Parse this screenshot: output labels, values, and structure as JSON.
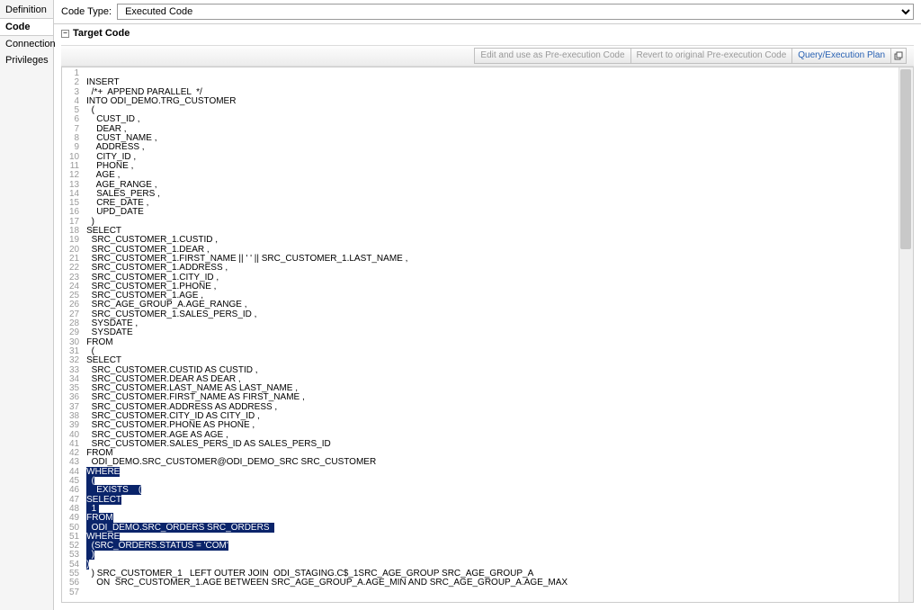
{
  "sidebar": {
    "items": [
      {
        "label": "Definition"
      },
      {
        "label": "Code"
      },
      {
        "label": "Connection"
      },
      {
        "label": "Privileges"
      }
    ],
    "active_index": 1
  },
  "topbar": {
    "label": "Code Type:",
    "selected": "Executed Code"
  },
  "section": {
    "title": "Target Code",
    "collapse_glyph": "−"
  },
  "toolbar": {
    "btn_preexec": "Edit and use as Pre-execution Code",
    "btn_revert": "Revert to original Pre-execution Code",
    "btn_plan": "Query/Execution Plan"
  },
  "code": {
    "lines": [
      {
        "n": 1,
        "t": ""
      },
      {
        "n": 2,
        "t": "INSERT"
      },
      {
        "n": 3,
        "t": "  /*+  APPEND PARALLEL  */"
      },
      {
        "n": 4,
        "t": "INTO ODI_DEMO.TRG_CUSTOMER"
      },
      {
        "n": 5,
        "t": "  ("
      },
      {
        "n": 6,
        "t": "    CUST_ID ,"
      },
      {
        "n": 7,
        "t": "    DEAR ,"
      },
      {
        "n": 8,
        "t": "    CUST_NAME ,"
      },
      {
        "n": 9,
        "t": "    ADDRESS ,"
      },
      {
        "n": 10,
        "t": "    CITY_ID ,"
      },
      {
        "n": 11,
        "t": "    PHONE ,"
      },
      {
        "n": 12,
        "t": "    AGE ,"
      },
      {
        "n": 13,
        "t": "    AGE_RANGE ,"
      },
      {
        "n": 14,
        "t": "    SALES_PERS ,"
      },
      {
        "n": 15,
        "t": "    CRE_DATE ,"
      },
      {
        "n": 16,
        "t": "    UPD_DATE"
      },
      {
        "n": 17,
        "t": "  )"
      },
      {
        "n": 18,
        "t": "SELECT"
      },
      {
        "n": 19,
        "t": "  SRC_CUSTOMER_1.CUSTID ,"
      },
      {
        "n": 20,
        "t": "  SRC_CUSTOMER_1.DEAR ,"
      },
      {
        "n": 21,
        "t": "  SRC_CUSTOMER_1.FIRST_NAME || ' ' || SRC_CUSTOMER_1.LAST_NAME ,"
      },
      {
        "n": 22,
        "t": "  SRC_CUSTOMER_1.ADDRESS ,"
      },
      {
        "n": 23,
        "t": "  SRC_CUSTOMER_1.CITY_ID ,"
      },
      {
        "n": 24,
        "t": "  SRC_CUSTOMER_1.PHONE ,"
      },
      {
        "n": 25,
        "t": "  SRC_CUSTOMER_1.AGE ,"
      },
      {
        "n": 26,
        "t": "  SRC_AGE_GROUP_A.AGE_RANGE ,"
      },
      {
        "n": 27,
        "t": "  SRC_CUSTOMER_1.SALES_PERS_ID ,"
      },
      {
        "n": 28,
        "t": "  SYSDATE ,"
      },
      {
        "n": 29,
        "t": "  SYSDATE"
      },
      {
        "n": 30,
        "t": "FROM"
      },
      {
        "n": 31,
        "t": "  ("
      },
      {
        "n": 32,
        "t": "SELECT"
      },
      {
        "n": 33,
        "t": "  SRC_CUSTOMER.CUSTID AS CUSTID ,"
      },
      {
        "n": 34,
        "t": "  SRC_CUSTOMER.DEAR AS DEAR ,"
      },
      {
        "n": 35,
        "t": "  SRC_CUSTOMER.LAST_NAME AS LAST_NAME ,"
      },
      {
        "n": 36,
        "t": "  SRC_CUSTOMER.FIRST_NAME AS FIRST_NAME ,"
      },
      {
        "n": 37,
        "t": "  SRC_CUSTOMER.ADDRESS AS ADDRESS ,"
      },
      {
        "n": 38,
        "t": "  SRC_CUSTOMER.CITY_ID AS CITY_ID ,"
      },
      {
        "n": 39,
        "t": "  SRC_CUSTOMER.PHONE AS PHONE ,"
      },
      {
        "n": 40,
        "t": "  SRC_CUSTOMER.AGE AS AGE ,"
      },
      {
        "n": 41,
        "t": "  SRC_CUSTOMER.SALES_PERS_ID AS SALES_PERS_ID"
      },
      {
        "n": 42,
        "t": "FROM"
      },
      {
        "n": 43,
        "t": "  ODI_DEMO.SRC_CUSTOMER@ODI_DEMO_SRC SRC_CUSTOMER"
      },
      {
        "n": 44,
        "t": "WHERE",
        "hl": true
      },
      {
        "n": 45,
        "t": "  (",
        "hl": true
      },
      {
        "n": 46,
        "t": "    EXISTS    (",
        "hl": true
      },
      {
        "n": 47,
        "t": "SELECT",
        "hl": true
      },
      {
        "n": 48,
        "t": "  1 ",
        "hl": true
      },
      {
        "n": 49,
        "t": "FROM",
        "hl": true
      },
      {
        "n": 50,
        "t": "  ODI_DEMO.SRC_ORDERS SRC_ORDERS  ",
        "hl": true
      },
      {
        "n": 51,
        "t": "WHERE",
        "hl": true
      },
      {
        "n": 52,
        "t": "  (SRC_ORDERS.STATUS = 'COM'",
        "hl": true
      },
      {
        "n": 53,
        "t": "  )",
        "hl": true
      },
      {
        "n": 54,
        "t": ")",
        "hl": true
      },
      {
        "n": 55,
        "t": "  ) SRC_CUSTOMER_1   LEFT OUTER JOIN  ODI_STAGING.C$_1SRC_AGE_GROUP SRC_AGE_GROUP_A"
      },
      {
        "n": 56,
        "t": "    ON  SRC_CUSTOMER_1.AGE BETWEEN SRC_AGE_GROUP_A.AGE_MIN AND SRC_AGE_GROUP_A.AGE_MAX"
      },
      {
        "n": 57,
        "t": ""
      }
    ]
  }
}
